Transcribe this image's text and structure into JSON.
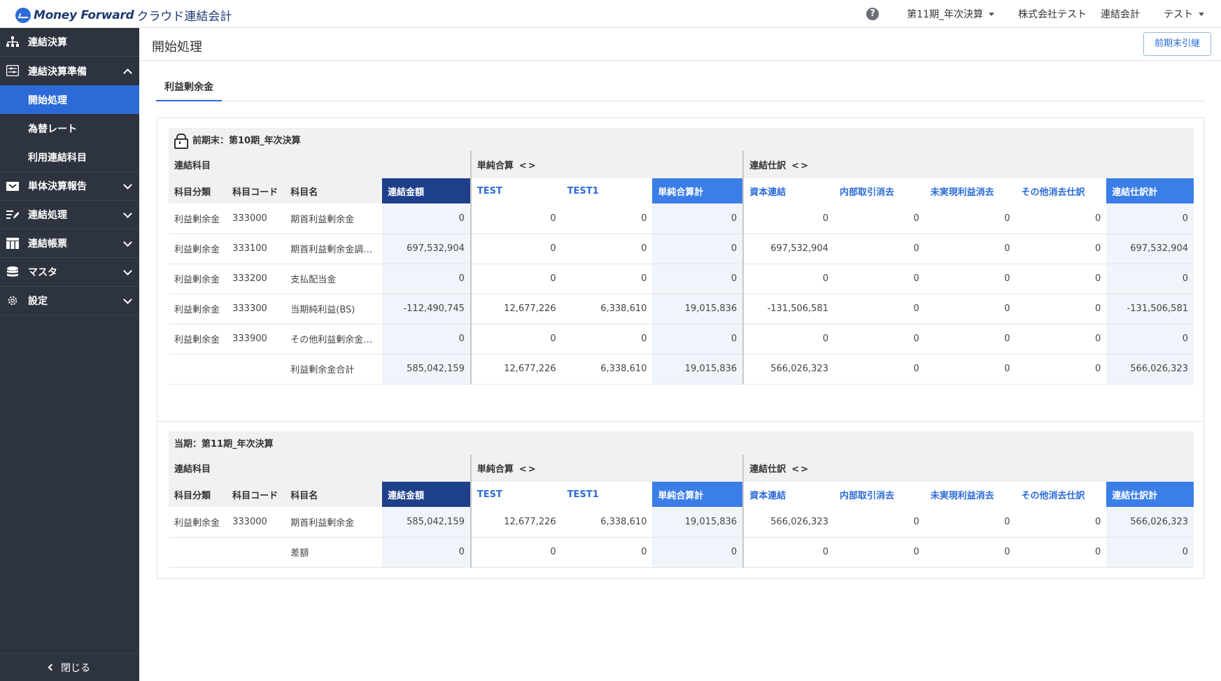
{
  "header": {
    "brand": "Money Forward",
    "product": "クラウド連結会計",
    "period": "第11期_年次決算",
    "company": "株式会社テスト",
    "product_short": "連結会計",
    "user": "テスト"
  },
  "sidebar": {
    "items": [
      {
        "label": "連結決算",
        "icon": "org-chart-icon"
      },
      {
        "label": "連結決算準備",
        "icon": "sliders-icon"
      },
      {
        "label": "単体決算報告",
        "icon": "inbox-icon"
      },
      {
        "label": "連結処理",
        "icon": "edit-list-icon"
      },
      {
        "label": "連結帳票",
        "icon": "table-icon"
      },
      {
        "label": "マスタ",
        "icon": "database-icon"
      },
      {
        "label": "設定",
        "icon": "gear-icon"
      }
    ],
    "sub_items": [
      "開始処理",
      "為替レート",
      "利用連結科目"
    ],
    "close_label": "閉じる"
  },
  "page": {
    "title": "開始処理",
    "carry_button": "前期末引継",
    "tab": "利益剰余金"
  },
  "columns": {
    "group_account": "連結科目",
    "group_simple": "単純合算",
    "group_elim": "連結仕訳",
    "headers": [
      "科目分類",
      "科目コード",
      "科目名",
      "連結金額",
      "TEST",
      "TEST1",
      "単純合算計",
      "資本連結",
      "内部取引消去",
      "未実現利益消去",
      "その他消去仕訳",
      "連結仕訳計"
    ]
  },
  "prior": {
    "title": "前期末：第10期_年次決算",
    "rows": [
      [
        "利益剰余金",
        "333000",
        "期首利益剰余金",
        "0",
        "0",
        "0",
        "0",
        "0",
        "0",
        "0",
        "0",
        "0"
      ],
      [
        "利益剰余金",
        "333100",
        "期首利益剰余金調整額",
        "697,532,904",
        "0",
        "0",
        "0",
        "697,532,904",
        "0",
        "0",
        "0",
        "697,532,904"
      ],
      [
        "利益剰余金",
        "333200",
        "支払配当金",
        "0",
        "0",
        "0",
        "0",
        "0",
        "0",
        "0",
        "0",
        "0"
      ],
      [
        "利益剰余金",
        "333300",
        "当期純利益(BS)",
        "-112,490,745",
        "12,677,226",
        "6,338,610",
        "19,015,836",
        "-131,506,581",
        "0",
        "0",
        "0",
        "-131,506,581"
      ],
      [
        "利益剰余金",
        "333900",
        "その他利益剰余金変...",
        "0",
        "0",
        "0",
        "0",
        "0",
        "0",
        "0",
        "0",
        "0"
      ],
      [
        "",
        "",
        "利益剰余金合計",
        "585,042,159",
        "12,677,226",
        "6,338,610",
        "19,015,836",
        "566,026,323",
        "0",
        "0",
        "0",
        "566,026,323"
      ]
    ]
  },
  "current": {
    "title": "当期：第11期_年次決算",
    "rows": [
      [
        "利益剰余金",
        "333000",
        "期首利益剰余金",
        "585,042,159",
        "12,677,226",
        "6,338,610",
        "19,015,836",
        "566,026,323",
        "0",
        "0",
        "0",
        "566,026,323"
      ],
      [
        "",
        "",
        "差額",
        "0",
        "0",
        "0",
        "0",
        "0",
        "0",
        "0",
        "0",
        "0"
      ]
    ]
  }
}
